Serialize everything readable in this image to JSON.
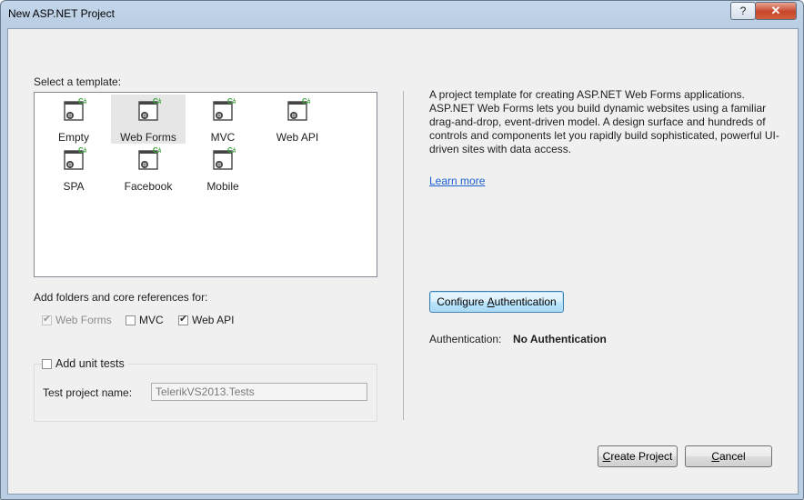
{
  "window": {
    "title": "New ASP.NET Project",
    "help_glyph": "?",
    "close_glyph": "✕"
  },
  "templates": {
    "header": "Select a template:",
    "items": [
      {
        "label": "Empty",
        "selected": false
      },
      {
        "label": "Web Forms",
        "selected": true
      },
      {
        "label": "MVC",
        "selected": false
      },
      {
        "label": "Web API",
        "selected": false
      },
      {
        "label": "SPA",
        "selected": false
      },
      {
        "label": "Facebook",
        "selected": false
      },
      {
        "label": "Mobile",
        "selected": false
      }
    ],
    "icon_badge": "C#"
  },
  "references": {
    "header": "Add folders and core references for:",
    "web_forms": {
      "label": "Web Forms",
      "checked": true,
      "enabled": false
    },
    "mvc": {
      "label": "MVC",
      "checked": false,
      "enabled": true
    },
    "web_api": {
      "label": "Web API",
      "checked": true,
      "enabled": true
    }
  },
  "unit_tests": {
    "label": "Add unit tests",
    "checked": false,
    "project_name_label": "Test project name:",
    "project_name_value": "TelerikVS2013.Tests"
  },
  "description": {
    "text": "A project template for creating ASP.NET Web Forms applications. ASP.NET Web Forms lets you build dynamic websites using a familiar drag-and-drop, event-driven model. A design surface and hundreds of controls and components let you rapidly build sophisticated, powerful UI-driven sites with data access.",
    "learn_more": "Learn more"
  },
  "authentication": {
    "configure_button_prefix": "Configure ",
    "configure_button_accel": "A",
    "configure_button_suffix": "uthentication",
    "label": "Authentication:",
    "value": "No Authentication"
  },
  "footer": {
    "create_accel": "C",
    "create_suffix": "reate Project",
    "cancel_accel": "C",
    "cancel_suffix": "ancel"
  },
  "colors": {
    "link": "#1c5fd0",
    "selection": "#e6e6e6",
    "icon_badge": "#3aa23a"
  }
}
